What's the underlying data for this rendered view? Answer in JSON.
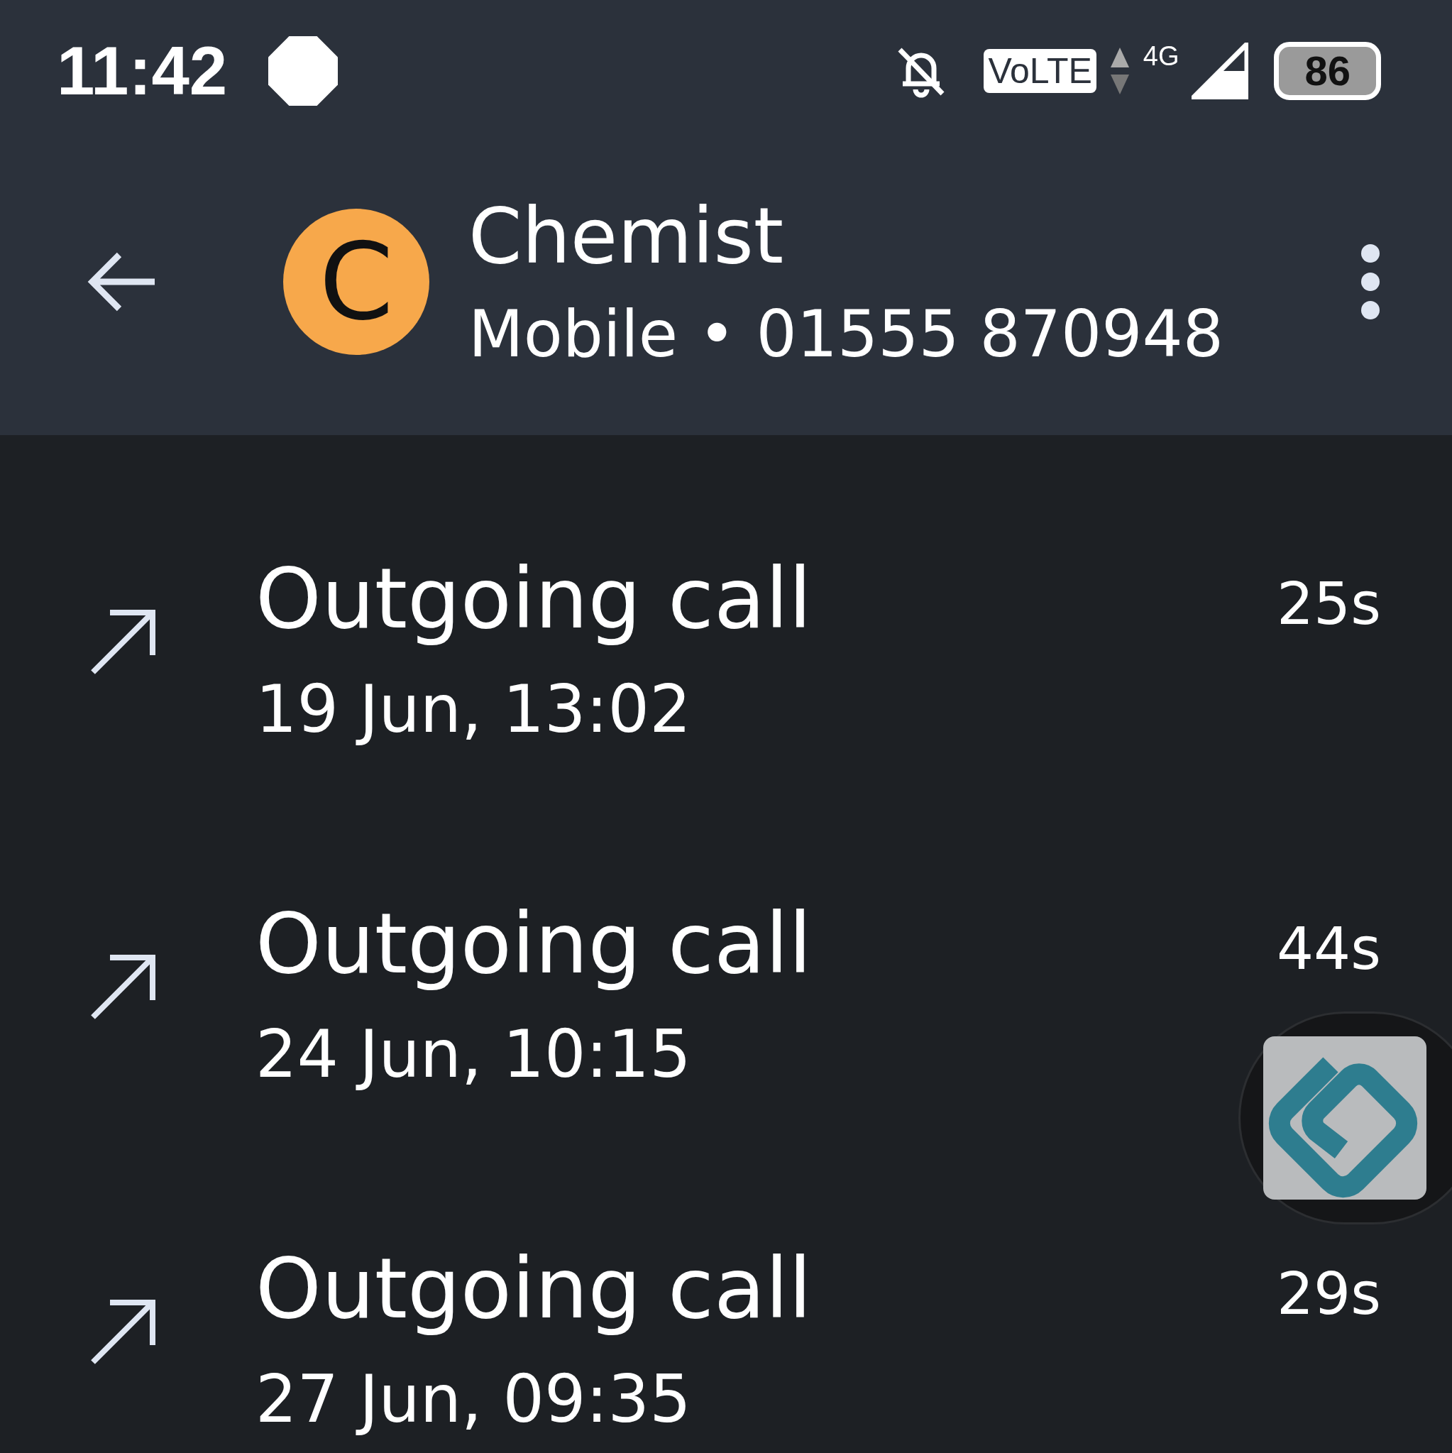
{
  "status_bar": {
    "time": "11:42",
    "network_badge": "VoLTE",
    "network_type": "4G",
    "battery": "86"
  },
  "header": {
    "avatar_letter": "C",
    "name": "Chemist",
    "subtitle": "Mobile • 01555 870948"
  },
  "calls": [
    {
      "type": "Outgoing call",
      "date": "19 Jun, 13:02",
      "duration": "25s"
    },
    {
      "type": "Outgoing call",
      "date": "24 Jun, 10:15",
      "duration": "44s"
    },
    {
      "type": "Outgoing call",
      "date": "27 Jun, 09:35",
      "duration": "29s"
    }
  ],
  "floating_bubble": {
    "shown": true
  }
}
